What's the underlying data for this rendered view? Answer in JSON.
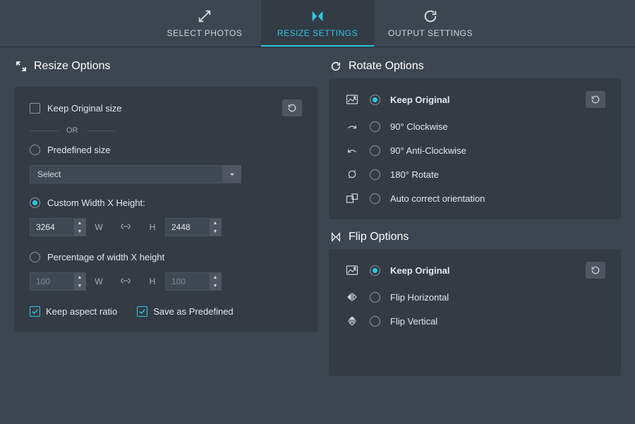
{
  "tabs": {
    "select_photos": "SELECT PHOTOS",
    "resize_settings": "RESIZE SETTINGS",
    "output_settings": "OUTPUT SETTINGS"
  },
  "resize": {
    "title": "Resize Options",
    "keep_original": "Keep Original size",
    "or": "OR",
    "predefined": "Predefined size",
    "select_placeholder": "Select",
    "custom": "Custom Width X Height:",
    "width_value": "3264",
    "height_value": "2448",
    "w_label": "W",
    "h_label": "H",
    "percentage": "Percentage of width X height",
    "pct_w": "100",
    "pct_h": "100",
    "keep_aspect": "Keep aspect ratio",
    "save_predefined": "Save as Predefined"
  },
  "rotate": {
    "title": "Rotate Options",
    "keep_original": "Keep Original",
    "cw90": "90° Clockwise",
    "acw90": "90° Anti-Clockwise",
    "r180": "180° Rotate",
    "auto": "Auto correct orientation"
  },
  "flip": {
    "title": "Flip Options",
    "keep_original": "Keep Original",
    "horizontal": "Flip Horizontal",
    "vertical": "Flip Vertical"
  }
}
